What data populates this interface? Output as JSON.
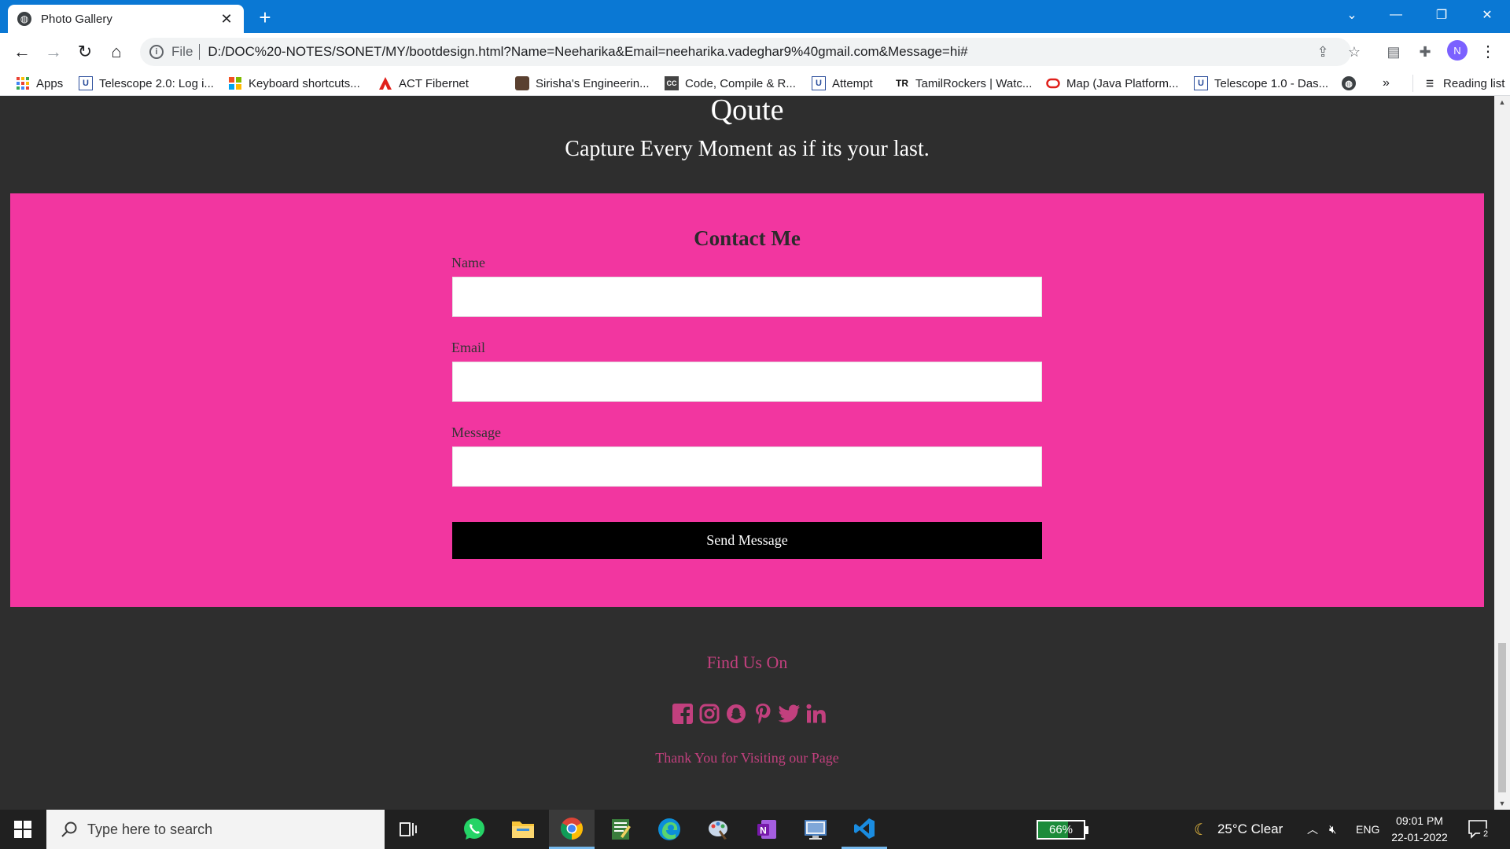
{
  "browser": {
    "tab_title": "Photo Gallery",
    "scheme_label": "File",
    "url": "D:/DOC%20-NOTES/SONET/MY/bootdesign.html?Name=Neeharika&Email=neeharika.vadeghar9%40gmail.com&Message=hi#",
    "profile_initial": "N"
  },
  "bookmarks": [
    {
      "label": "Apps",
      "icon": "apps-grid-icon"
    },
    {
      "label": "Telescope 2.0: Log i...",
      "icon": "telescope-icon"
    },
    {
      "label": "Keyboard shortcuts...",
      "icon": "microsoft-icon"
    },
    {
      "label": "ACT Fibernet",
      "icon": "act-icon"
    },
    {
      "label": "Sirisha's Engineerin...",
      "icon": "avatar-icon"
    },
    {
      "label": "Code, Compile & R...",
      "icon": "cc-icon"
    },
    {
      "label": "Attempt",
      "icon": "telescope-icon"
    },
    {
      "label": "TamilRockers | Watc...",
      "icon": "tr-icon"
    },
    {
      "label": "Map (Java Platform...",
      "icon": "oracle-icon"
    },
    {
      "label": "Telescope 1.0 - Das...",
      "icon": "telescope-icon"
    }
  ],
  "bookmarks_more": "»",
  "reading_list": "Reading list",
  "page": {
    "quote_title": "Qoute",
    "quote_text": "Capture Every Moment as if its your last.",
    "contact": {
      "heading": "Contact Me",
      "name_label": "Name",
      "email_label": "Email",
      "message_label": "Message",
      "name_value": "",
      "email_value": "",
      "message_value": "",
      "submit_label": "Send Message",
      "bg_color": "#f236a0"
    },
    "find_us": "Find Us On",
    "socials": [
      "facebook-icon",
      "instagram-icon",
      "snapchat-icon",
      "pinterest-icon",
      "twitter-icon",
      "linkedin-icon"
    ],
    "thanks": "Thank You for Visiting our Page",
    "accent_color": "#c2407e"
  },
  "taskbar": {
    "search_placeholder": "Type here to search",
    "battery": "66%",
    "weather": "25°C  Clear",
    "language": "ENG",
    "time": "09:01 PM",
    "date": "22-01-2022",
    "notifications": "2"
  }
}
